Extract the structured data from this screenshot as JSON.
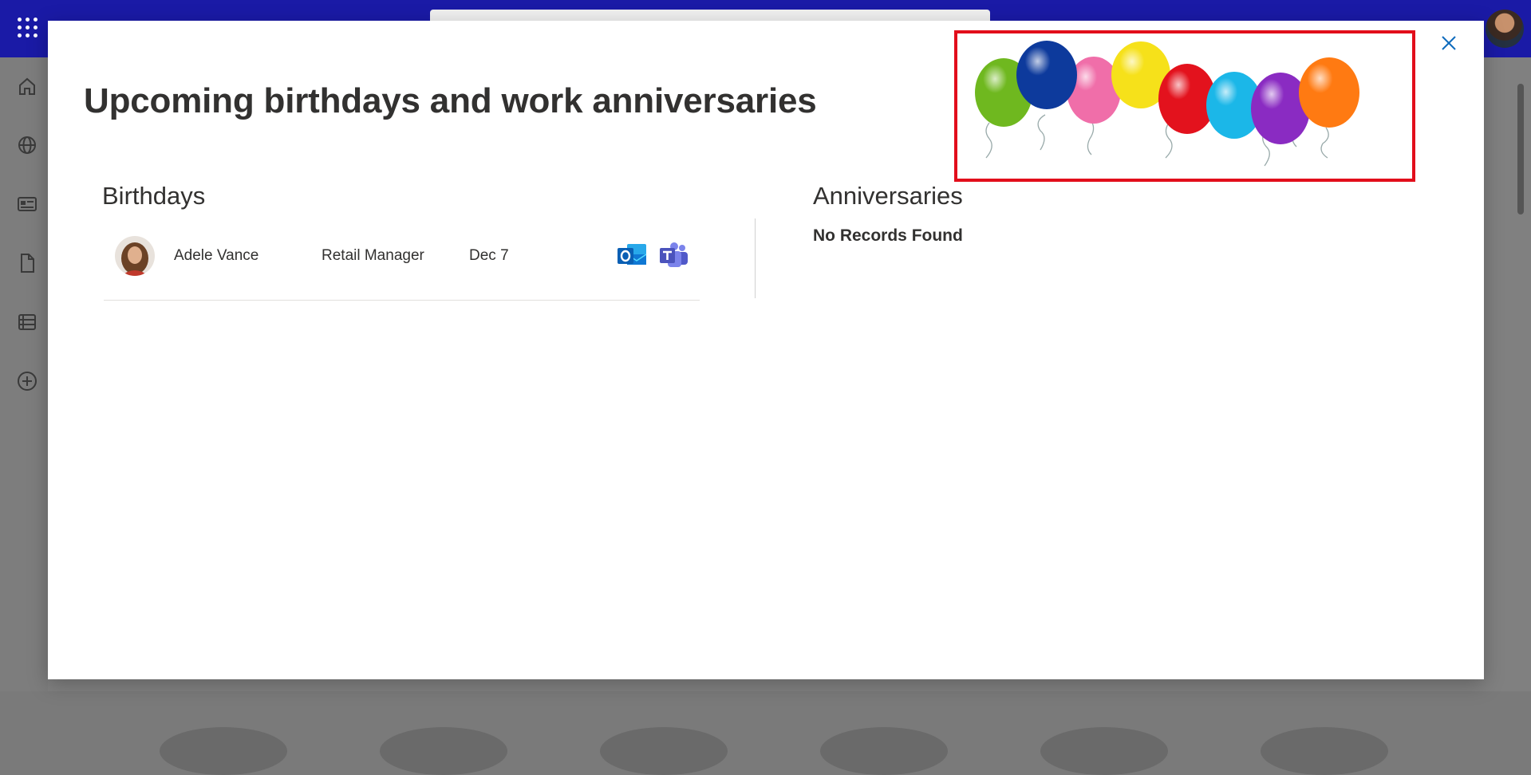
{
  "dialog": {
    "title": "Upcoming birthdays and work anniversaries",
    "close_icon": "close-icon"
  },
  "birthdays": {
    "heading": "Birthdays",
    "rows": [
      {
        "name": "Adele Vance",
        "job_title": "Retail Manager",
        "date": "Dec 7",
        "actions": [
          "outlook-icon",
          "teams-icon"
        ]
      }
    ]
  },
  "anniversaries": {
    "heading": "Anniversaries",
    "empty_message": "No Records Found"
  },
  "decoration": {
    "image": "balloons",
    "highlight_color": "#e20e1b"
  },
  "colors": {
    "suite_bar": "#1a1aa6",
    "accent": "#0f6cbd",
    "outlook": "#0f78d4",
    "teams": "#5059c9"
  },
  "left_rail": {
    "icons": [
      "home-icon",
      "globe-icon",
      "news-icon",
      "document-icon",
      "list-icon",
      "add-icon"
    ]
  }
}
